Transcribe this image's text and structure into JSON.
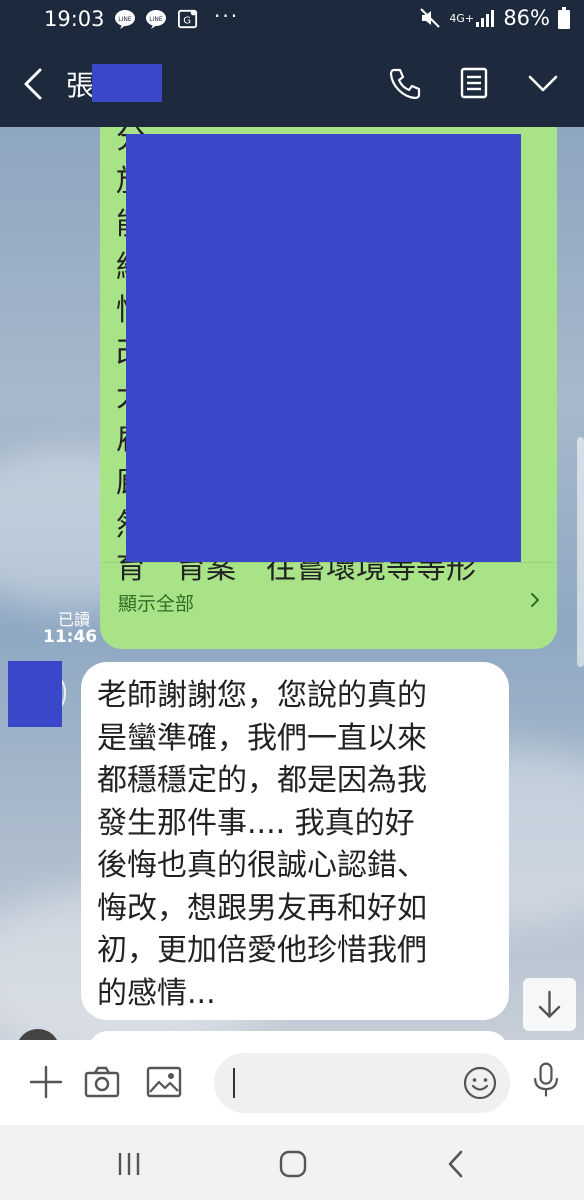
{
  "status": {
    "time": "19:03",
    "dots": "···",
    "network": "4G+",
    "battery": "86%",
    "noti_labels": [
      "LINE",
      "LINE",
      "G"
    ]
  },
  "header": {
    "contact_name": "張"
  },
  "messages": {
    "mine": {
      "partial_lines": [
        "分",
        "放",
        "能",
        "給",
        "悟",
        "改",
        "大",
        "雇",
        "廊",
        "然",
        "育　育案　往嘗壞境等等形"
      ],
      "show_all": "顯示全部",
      "read_label": "已讀",
      "time": "11:46"
    },
    "theirs": {
      "lines": [
        "老師謝謝您，您說的真的",
        "是蠻準確，我們一直以來",
        "都穩穩定的，都是因為我",
        "發生那件事.... 我真的好",
        "後悔也真的很誠心認錯、",
        "悔改，想跟男友再和好如",
        "初，更加倍愛他珍惜我們",
        "的感情..."
      ]
    }
  },
  "colors": {
    "header_bg": "#1d2a3d",
    "mine_bubble": "#a8e388",
    "redaction": "#3b47c9",
    "show_all_text": "#2f6f26"
  }
}
